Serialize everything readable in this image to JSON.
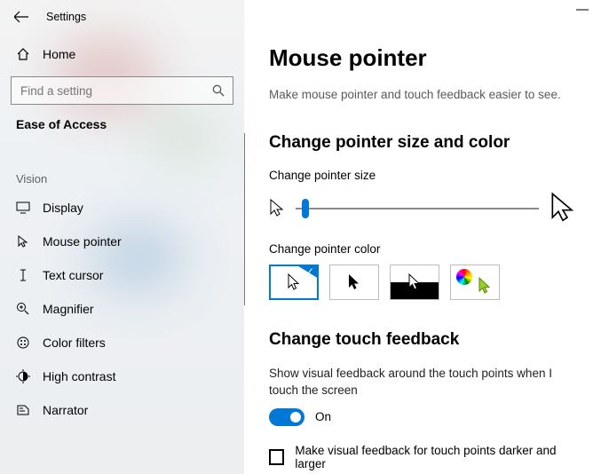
{
  "window": {
    "title": "Settings"
  },
  "sidebar": {
    "home_label": "Home",
    "search_placeholder": "Find a setting",
    "section_title": "Ease of Access",
    "group_label": "Vision",
    "items": [
      {
        "label": "Display",
        "icon": "display-icon"
      },
      {
        "label": "Mouse pointer",
        "icon": "mouse-pointer-icon"
      },
      {
        "label": "Text cursor",
        "icon": "text-cursor-icon"
      },
      {
        "label": "Magnifier",
        "icon": "magnifier-icon"
      },
      {
        "label": "Color filters",
        "icon": "color-filters-icon"
      },
      {
        "label": "High contrast",
        "icon": "high-contrast-icon"
      },
      {
        "label": "Narrator",
        "icon": "narrator-icon"
      }
    ]
  },
  "main": {
    "title": "Mouse pointer",
    "subtitle": "Make mouse pointer and touch feedback easier to see.",
    "size_section": "Change pointer size and color",
    "size_label": "Change pointer size",
    "size_value_percent": 4,
    "color_label": "Change pointer color",
    "color_selected_index": 0,
    "touch_section": "Change touch feedback",
    "touch_desc": "Show visual feedback around the touch points when I touch the screen",
    "touch_toggle": {
      "on": true,
      "label": "On"
    },
    "touch_checkbox": {
      "checked": false,
      "label": "Make visual feedback for touch points darker and larger"
    }
  },
  "colors": {
    "accent": "#0078d4"
  }
}
